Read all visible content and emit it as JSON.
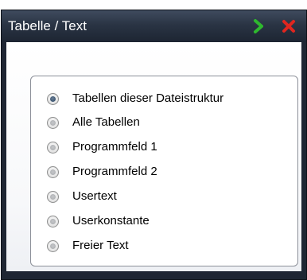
{
  "window": {
    "title": "Tabelle / Text",
    "ok_icon": "green-chevron-right-icon",
    "close_icon": "red-x-icon",
    "ok_color": "#2eb82e",
    "close_color": "#e0261f"
  },
  "options": {
    "selected": "Tabellen dieser Dateistruktur",
    "items": [
      {
        "label": "Tabellen dieser Dateistruktur",
        "checked": true
      },
      {
        "label": "Alle Tabellen",
        "checked": false
      },
      {
        "label": "Programmfeld 1",
        "checked": false
      },
      {
        "label": "Programmfeld 2",
        "checked": false
      },
      {
        "label": "Usertext",
        "checked": false
      },
      {
        "label": "Userkonstante",
        "checked": false
      },
      {
        "label": "Freier Text",
        "checked": false
      }
    ]
  }
}
